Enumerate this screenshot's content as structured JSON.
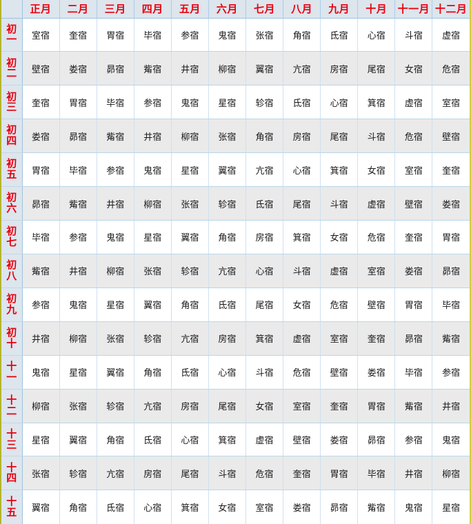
{
  "table": {
    "corner_label": "",
    "months": [
      "正月",
      "二月",
      "三月",
      "四月",
      "五月",
      "六月",
      "七月",
      "八月",
      "九月",
      "十月",
      "十一月",
      "十二月"
    ],
    "days": [
      "初一",
      "初二",
      "初三",
      "初四",
      "初五",
      "初六",
      "初七",
      "初八",
      "初九",
      "初十",
      "十一",
      "十二",
      "十三",
      "十四",
      "十五"
    ],
    "rows": [
      [
        "室宿",
        "奎宿",
        "胃宿",
        "毕宿",
        "参宿",
        "鬼宿",
        "张宿",
        "角宿",
        "氐宿",
        "心宿",
        "斗宿",
        "虚宿"
      ],
      [
        "壁宿",
        "娄宿",
        "昴宿",
        "觜宿",
        "井宿",
        "柳宿",
        "翼宿",
        "亢宿",
        "房宿",
        "尾宿",
        "女宿",
        "危宿"
      ],
      [
        "奎宿",
        "胃宿",
        "毕宿",
        "参宿",
        "鬼宿",
        "星宿",
        "轸宿",
        "氐宿",
        "心宿",
        "箕宿",
        "虚宿",
        "室宿"
      ],
      [
        "娄宿",
        "昴宿",
        "觜宿",
        "井宿",
        "柳宿",
        "张宿",
        "角宿",
        "房宿",
        "尾宿",
        "斗宿",
        "危宿",
        "壁宿"
      ],
      [
        "胃宿",
        "毕宿",
        "参宿",
        "鬼宿",
        "星宿",
        "翼宿",
        "亢宿",
        "心宿",
        "箕宿",
        "女宿",
        "室宿",
        "奎宿"
      ],
      [
        "昴宿",
        "觜宿",
        "井宿",
        "柳宿",
        "张宿",
        "轸宿",
        "氐宿",
        "尾宿",
        "斗宿",
        "虚宿",
        "壁宿",
        "娄宿"
      ],
      [
        "毕宿",
        "参宿",
        "鬼宿",
        "星宿",
        "翼宿",
        "角宿",
        "房宿",
        "箕宿",
        "女宿",
        "危宿",
        "奎宿",
        "胃宿"
      ],
      [
        "觜宿",
        "井宿",
        "柳宿",
        "张宿",
        "轸宿",
        "亢宿",
        "心宿",
        "斗宿",
        "虚宿",
        "室宿",
        "娄宿",
        "昴宿"
      ],
      [
        "参宿",
        "鬼宿",
        "星宿",
        "翼宿",
        "角宿",
        "氐宿",
        "尾宿",
        "女宿",
        "危宿",
        "壁宿",
        "胃宿",
        "毕宿"
      ],
      [
        "井宿",
        "柳宿",
        "张宿",
        "轸宿",
        "亢宿",
        "房宿",
        "箕宿",
        "虚宿",
        "室宿",
        "奎宿",
        "昴宿",
        "觜宿"
      ],
      [
        "鬼宿",
        "星宿",
        "翼宿",
        "角宿",
        "氐宿",
        "心宿",
        "斗宿",
        "危宿",
        "壁宿",
        "娄宿",
        "毕宿",
        "参宿"
      ],
      [
        "柳宿",
        "张宿",
        "轸宿",
        "亢宿",
        "房宿",
        "尾宿",
        "女宿",
        "室宿",
        "奎宿",
        "胃宿",
        "觜宿",
        "井宿"
      ],
      [
        "星宿",
        "翼宿",
        "角宿",
        "氐宿",
        "心宿",
        "箕宿",
        "虚宿",
        "壁宿",
        "娄宿",
        "昴宿",
        "参宿",
        "鬼宿"
      ],
      [
        "张宿",
        "轸宿",
        "亢宿",
        "房宿",
        "尾宿",
        "斗宿",
        "危宿",
        "奎宿",
        "胃宿",
        "毕宿",
        "井宿",
        "柳宿"
      ],
      [
        "翼宿",
        "角宿",
        "氐宿",
        "心宿",
        "箕宿",
        "女宿",
        "室宿",
        "娄宿",
        "昴宿",
        "觜宿",
        "鬼宿",
        "星宿"
      ]
    ]
  },
  "colors": {
    "header_text": "#e8000d",
    "header_bg": "#dde5ed",
    "day_col_bg": "#dde5ed",
    "row_odd_bg": "#ffffff",
    "row_even_bg": "#eaeaea",
    "grid_line": "#b9d6ea",
    "outer_border": "#b5b52a"
  }
}
